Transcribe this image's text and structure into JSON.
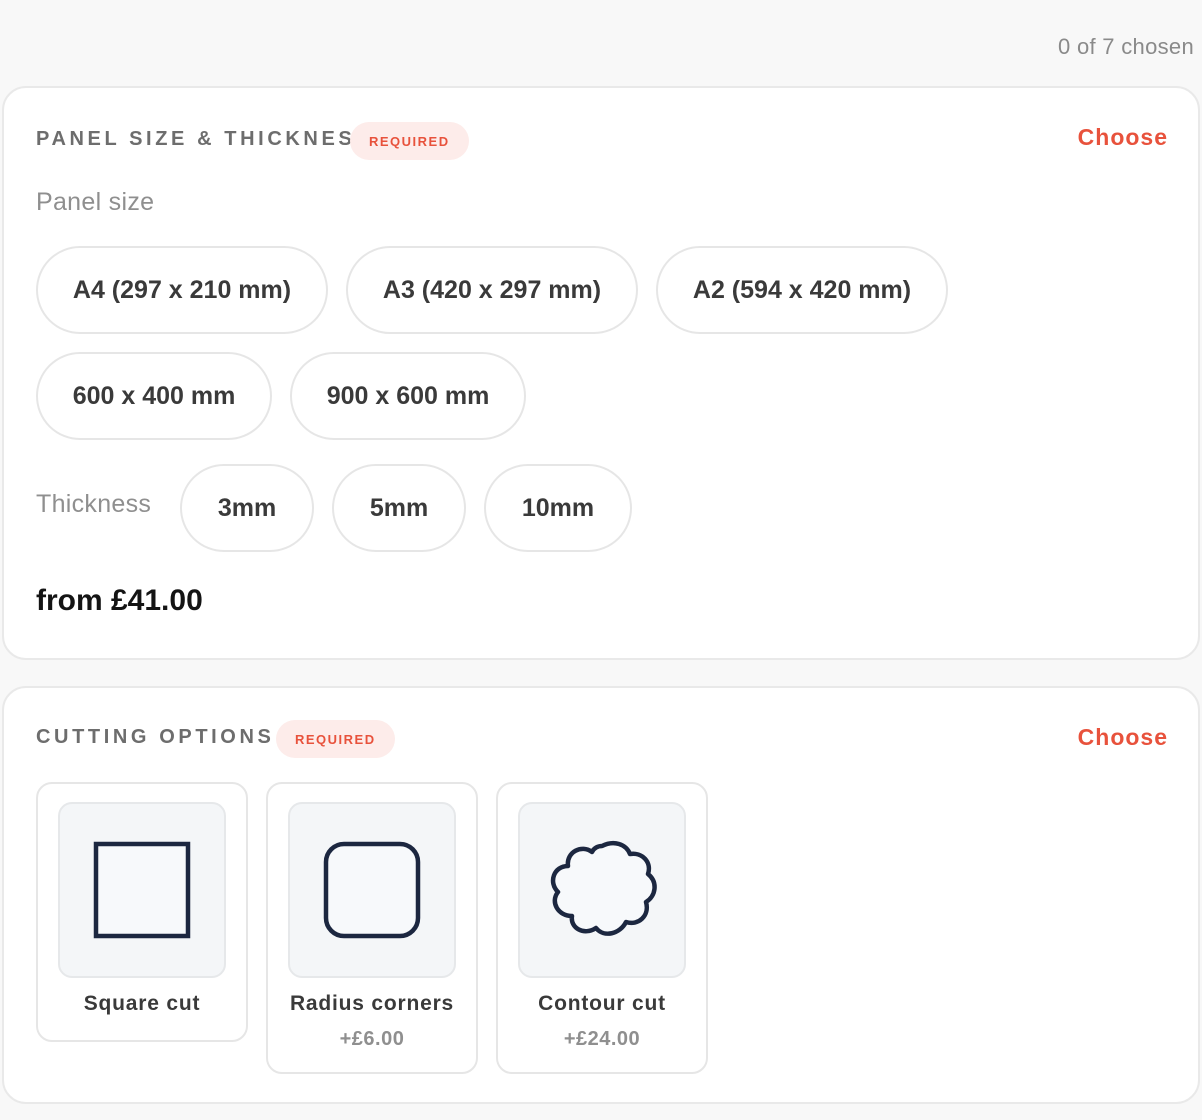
{
  "selection_counter": "0 of 7 chosen",
  "panel_section": {
    "title": "PANEL SIZE & THICKNESS",
    "badge": "REQUIRED",
    "choose_label": "Choose",
    "panel_size_label": "Panel size",
    "sizes": [
      "A4 (297 x 210 mm)",
      "A3 (420 x 297 mm)",
      "A2 (594 x 420 mm)",
      "600 x 400 mm",
      "900 x 600 mm"
    ],
    "thickness_label": "Thickness",
    "thicknesses": [
      "3mm",
      "5mm",
      "10mm"
    ],
    "price_from": "from £41.00"
  },
  "cutting_section": {
    "title": "CUTTING OPTIONS",
    "badge": "REQUIRED",
    "choose_label": "Choose",
    "options": [
      {
        "name": "Square cut",
        "price": "",
        "icon": "square-cut-icon"
      },
      {
        "name": "Radius corners",
        "price": "+£6.00",
        "icon": "radius-corners-icon"
      },
      {
        "name": "Contour cut",
        "price": "+£24.00",
        "icon": "contour-cut-icon"
      }
    ]
  },
  "colors": {
    "accent": "#e8523c",
    "badge_bg": "#fdecea",
    "icon_stroke": "#1c2740"
  }
}
